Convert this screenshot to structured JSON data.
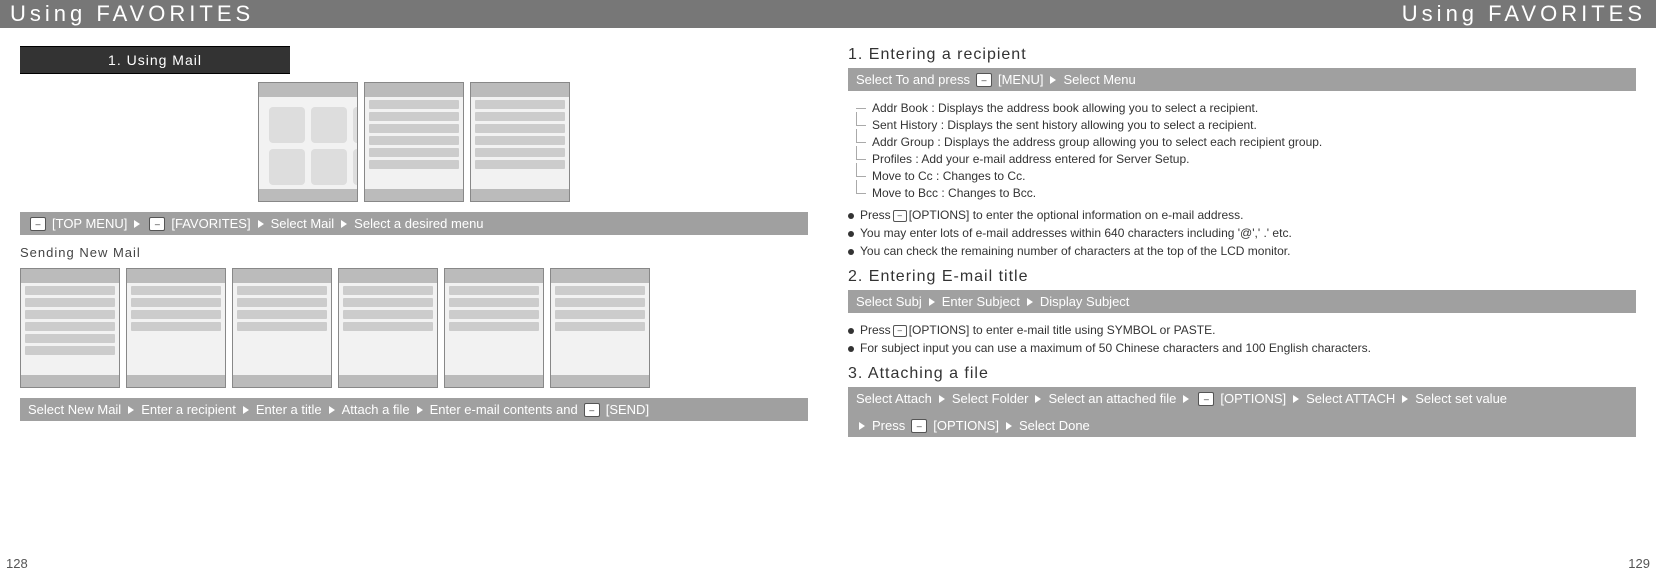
{
  "header_left": "Using FAVORITES",
  "header_right": "Using FAVORITES",
  "page_num_left": "128",
  "page_num_right": "129",
  "left": {
    "tab": "1. Using Mail",
    "bar1": {
      "top_menu": "[TOP MENU]",
      "favorites": "[FAVORITES]",
      "select_mail": "Select Mail",
      "select_desired": "Select a desired menu"
    },
    "subheading": "Sending New Mail",
    "bar2": {
      "select_new": "Select New Mail",
      "enter_recipient": "Enter a recipient",
      "enter_title": "Enter a title",
      "attach_file": "Attach a file",
      "enter_contents": "Enter e-mail contents and",
      "send": "[SEND]"
    }
  },
  "right": {
    "s1": {
      "title": "1. Entering a recipient",
      "bar": {
        "select_to": "Select To and press",
        "menu": "[MENU]",
        "select_menu": "Select Menu"
      },
      "tree": {
        "addr_book": "Addr Book : Displays the address book allowing you to select a recipient.",
        "sent_history": "Sent History : Displays the sent history allowing you to select a recipient.",
        "addr_group": "Addr Group : Displays the address group allowing you to select each recipient group.",
        "profiles": "Profiles : Add your e-mail address entered for Server Setup.",
        "move_cc": "Move to Cc : Changes to Cc.",
        "move_bcc": "Move to Bcc : Changes to Bcc."
      },
      "bullets": {
        "b1a": "Press",
        "b1b": "[OPTIONS] to enter the optional information on e-mail address.",
        "b2": "You may enter lots of e-mail addresses within 640 characters including '@',' .' etc.",
        "b3": "You can check the remaining number of characters at the top of the LCD monitor."
      }
    },
    "s2": {
      "title": "2. Entering E-mail title",
      "bar": {
        "select_subj": "Select Subj",
        "enter_subject": "Enter Subject",
        "display_subject": "Display Subject"
      },
      "bullets": {
        "b1a": "Press",
        "b1b": "[OPTIONS] to enter e-mail title using SYMBOL or PASTE.",
        "b2": "For subject input you can use a maximum of 50 Chinese characters and 100 English characters."
      }
    },
    "s3": {
      "title": "3. Attaching a file",
      "bar": {
        "select_attach": "Select Attach",
        "select_folder": "Select Folder",
        "select_file": "Select an attached file",
        "options": "[OPTIONS]",
        "select_attach2": "Select ATTACH",
        "select_set": "Select set value",
        "press": "Press",
        "options2": "[OPTIONS]",
        "select_done": "Select Done"
      }
    }
  }
}
